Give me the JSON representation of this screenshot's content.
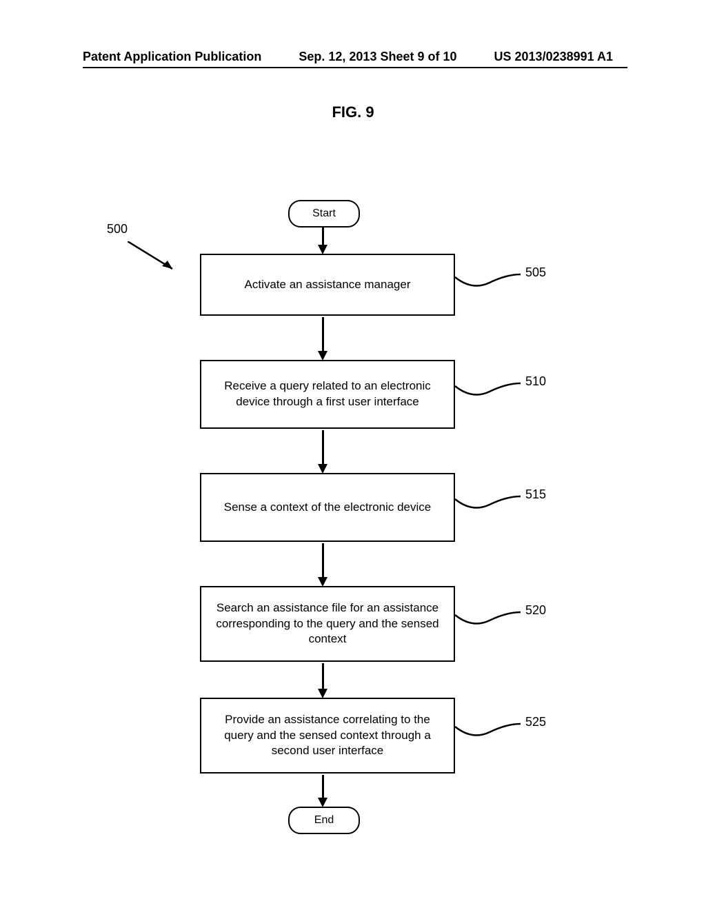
{
  "header": {
    "left": "Patent Application Publication",
    "center": "Sep. 12, 2013  Sheet 9 of 10",
    "right": "US 2013/0238991 A1"
  },
  "figure": {
    "title": "FIG. 9",
    "overall_ref": "500",
    "start": "Start",
    "end": "End",
    "steps": [
      {
        "ref": "505",
        "text": "Activate an assistance manager"
      },
      {
        "ref": "510",
        "text": "Receive a query related to an electronic device through a first user interface"
      },
      {
        "ref": "515",
        "text": "Sense a context of the electronic device"
      },
      {
        "ref": "520",
        "text": "Search an assistance file for an assistance corresponding to the query and the sensed context"
      },
      {
        "ref": "525",
        "text": "Provide an assistance correlating to the query and the sensed context through a second user interface"
      }
    ]
  }
}
